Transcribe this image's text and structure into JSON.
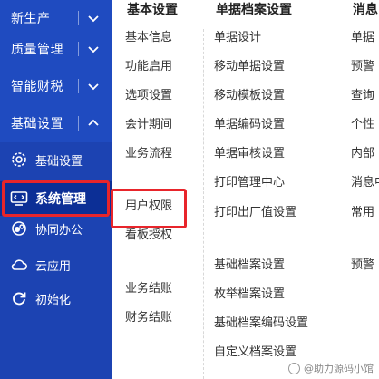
{
  "sidebar": {
    "groups": [
      {
        "label": "新生产",
        "state": "collapsed"
      },
      {
        "label": "质量管理",
        "state": "collapsed"
      },
      {
        "label": "智能财税",
        "state": "collapsed"
      },
      {
        "label": "基础设置",
        "state": "expanded"
      }
    ],
    "sub_items": [
      {
        "label": "基础设置",
        "icon": "settings-gear-icon"
      },
      {
        "label": "系统管理",
        "icon": "monitor-gear-icon",
        "active": true
      },
      {
        "label": "协同办公",
        "icon": "collaboration-icon"
      },
      {
        "label": "云应用",
        "icon": "cloud-icon"
      },
      {
        "label": "初始化",
        "icon": "refresh-icon"
      }
    ],
    "colors": {
      "background": "#1f4bc0",
      "active": "#0c2f96"
    }
  },
  "columns": [
    {
      "title": "基本设置",
      "items": [
        "基本信息",
        "功能启用",
        "选项设置",
        "会计期间",
        "业务流程",
        "用户权限",
        "看板授权",
        "业务结账",
        "财务结账"
      ]
    },
    {
      "title": "单据档案设置",
      "items": [
        "单据设计",
        "移动单据设置",
        "移动模板设置",
        "单据编码设置",
        "单据审核设置",
        "打印管理中心",
        "打印出厂值设置",
        "基础档案设置",
        "枚举档案设置",
        "基础档案编码设置",
        "自定义档案设置"
      ]
    },
    {
      "title": "消息",
      "items": [
        "单据",
        "预警",
        "查询",
        "个性",
        "内部",
        "消息中",
        "常用",
        "预警"
      ]
    }
  ],
  "highlight_color": "#e8252b",
  "watermark": "@助力源码小馆"
}
